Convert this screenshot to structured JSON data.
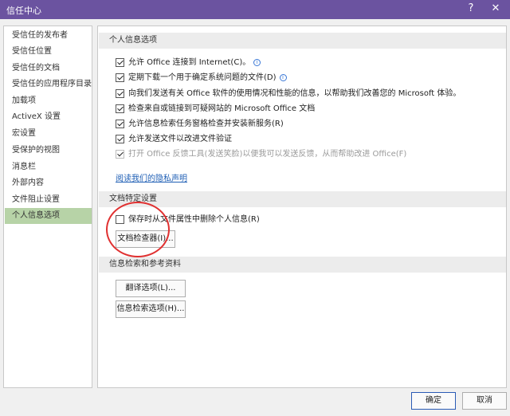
{
  "window": {
    "title": "信任中心",
    "help_glyph": "?",
    "close_glyph": "✕"
  },
  "sidebar": {
    "items": [
      {
        "label": "受信任的发布者"
      },
      {
        "label": "受信任位置"
      },
      {
        "label": "受信任的文档"
      },
      {
        "label": "受信任的应用程序目录"
      },
      {
        "label": "加载项"
      },
      {
        "label": "ActiveX 设置"
      },
      {
        "label": "宏设置"
      },
      {
        "label": "受保护的视图"
      },
      {
        "label": "消息栏"
      },
      {
        "label": "外部内容"
      },
      {
        "label": "文件阻止设置"
      },
      {
        "label": "个人信息选项"
      }
    ],
    "selected": "个人信息选项"
  },
  "privacy": {
    "heading": "个人信息选项",
    "options": [
      {
        "label": "允许 Office 连接到 Internet(C)。",
        "checked": true,
        "info": true
      },
      {
        "label": "定期下载一个用于确定系统问题的文件(D)",
        "checked": true,
        "info": true
      },
      {
        "label": "向我们发送有关 Office 软件的使用情况和性能的信息，以帮助我们改善您的 Microsoft 体验。",
        "checked": true,
        "info": false
      },
      {
        "label": "检查来自或链接到可疑网站的 Microsoft Office 文档",
        "checked": true,
        "info": false
      },
      {
        "label": "允许信息检索任务窗格检查并安装新服务(R)",
        "checked": true,
        "info": false
      },
      {
        "label": "允许发送文件以改进文件验证",
        "checked": true,
        "info": false
      },
      {
        "label": "打开 Office 反馈工具(发送笑脸)以便我可以发送反馈，从而帮助改进 Office(F)",
        "checked": true,
        "info": false,
        "disabled": true
      }
    ],
    "privacy_link": "阅读我们的隐私声明"
  },
  "document_settings": {
    "heading": "文档特定设置",
    "remove_props_label": "保存时从文件属性中删除个人信息(R)",
    "remove_props_checked": false,
    "inspector_button": "文档检查器(I)..."
  },
  "research": {
    "heading": "信息检索和参考资料",
    "translation_button": "翻译选项(L)...",
    "research_button": "信息检索选项(H)..."
  },
  "footer": {
    "ok": "确定",
    "cancel": "取消"
  },
  "colors": {
    "titlebar": "#6b53a0",
    "selected_item": "#b7d3a7",
    "link": "#1f5fb5",
    "highlight_circle": "#e03030"
  },
  "icons": {
    "info": "info-icon",
    "check": "checkmark"
  }
}
